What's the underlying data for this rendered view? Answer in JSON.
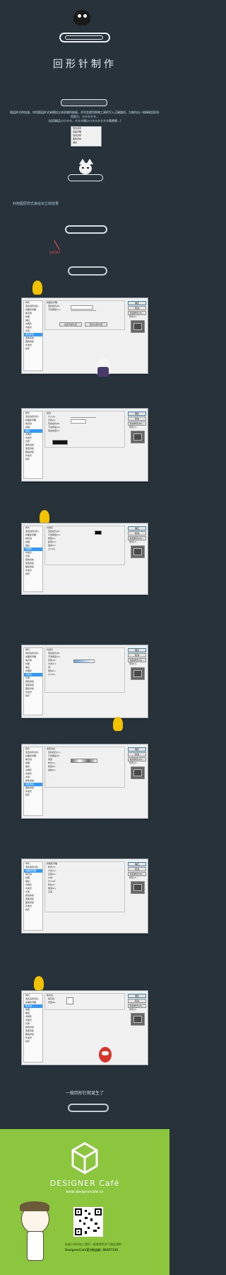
{
  "header": {
    "title": "回形针制作",
    "intro_line1": "图层样式的加减，何用图层样式来模拟立体质感的曲面，并学会使用钢笔工具的写入正确路径，为制作出一枚精致回形针而努力，卡卡卡卡卡…",
    "intro_line2": "(适用精品小小卡卡，卡卡卡哦小小卡卡卡卡卡卡哦喂喂…)",
    "step_note": "利用图层样式来给出立体效果",
    "color_code": "b7b7b7",
    "ending": "一枚回形针就诞生了"
  },
  "small_dialog": {
    "items": [
      "混合选项",
      "斜面浮雕",
      "混合边缘",
      "图案叠加",
      "描边"
    ]
  },
  "ps_dialogs": [
    {
      "title": "斜面和浮雕",
      "sidebar": [
        "样式",
        "混合选项:默认",
        "斜面和浮雕",
        "等高线",
        "纹理",
        "描边",
        "内阴影",
        "内发光",
        "光泽",
        "颜色叠加",
        "渐变叠加",
        "图案叠加",
        "外发光",
        "投影"
      ],
      "selected": 9,
      "buttons": [
        "确定",
        "取消",
        "新建样式(W)...",
        "预览(V)"
      ],
      "rows": [
        "混合模式(B):",
        "不透明度(O):",
        "设置为默认值",
        "复位为默认值"
      ]
    },
    {
      "title": "描边",
      "sidebar": [
        "样式",
        "混合选项:默认",
        "斜面和浮雕",
        "等高线",
        "纹理",
        "描边",
        "内阴影",
        "内发光",
        "光泽",
        "颜色叠加",
        "渐变叠加",
        "图案叠加",
        "外发光",
        "投影"
      ],
      "selected": 5,
      "buttons": [
        "确定",
        "取消",
        "新建样式(W)...",
        "预览(V)"
      ],
      "rows": [
        "大小(S):",
        "位置(P):",
        "混合模式(B):",
        "不透明度(O):",
        "填充类型(F):"
      ]
    },
    {
      "title": "内阴影",
      "sidebar": [
        "样式",
        "混合选项:默认",
        "斜面和浮雕",
        "等高线",
        "纹理",
        "描边",
        "内阴影",
        "内发光",
        "光泽",
        "颜色叠加",
        "渐变叠加",
        "图案叠加",
        "外发光",
        "投影"
      ],
      "selected": 6,
      "buttons": [
        "确定",
        "取消",
        "新建样式(W)...",
        "预览(V)"
      ],
      "rows": [
        "混合模式(B):",
        "不透明度(O):",
        "角度(A):",
        "距离(D):",
        "阻塞(C):",
        "大小(S):"
      ]
    },
    {
      "title": "内发光",
      "sidebar": [
        "样式",
        "混合选项:默认",
        "斜面和浮雕",
        "等高线",
        "纹理",
        "描边",
        "内阴影",
        "内发光",
        "光泽",
        "颜色叠加",
        "渐变叠加",
        "图案叠加",
        "外发光",
        "投影"
      ],
      "selected": 7,
      "buttons": [
        "确定",
        "取消",
        "新建样式(W)...",
        "预览(V)"
      ],
      "rows": [
        "混合模式(B):",
        "不透明度(O):",
        "杂色(N):",
        "方法(Q):",
        "源:",
        "阻塞(C):",
        "大小(S):"
      ]
    },
    {
      "title": "渐变叠加",
      "sidebar": [
        "样式",
        "混合选项:默认",
        "斜面和浮雕",
        "等高线",
        "纹理",
        "描边",
        "内阴影",
        "内发光",
        "光泽",
        "颜色叠加",
        "渐变叠加",
        "图案叠加",
        "外发光",
        "投影"
      ],
      "selected": 10,
      "buttons": [
        "确定",
        "取消",
        "新建样式(W)...",
        "预览(V)"
      ],
      "rows": [
        "混合模式(O):",
        "不透明度(P):",
        "渐变:",
        "样式(L):",
        "角度(N):",
        "缩放(S):"
      ]
    },
    {
      "title": "斜面和浮雕",
      "sidebar": [
        "样式",
        "混合选项:默认",
        "斜面和浮雕",
        "等高线",
        "纹理",
        "描边",
        "内阴影",
        "内发光",
        "光泽",
        "颜色叠加",
        "渐变叠加",
        "图案叠加",
        "外发光",
        "投影"
      ],
      "selected": 2,
      "buttons": [
        "确定",
        "取消",
        "新建样式(W)...",
        "预览(V)"
      ],
      "rows": [
        "样式(T):",
        "方法(Q):",
        "深度(D):",
        "方向:",
        "大小(Z):",
        "软化(F):",
        "角度(N):",
        "高度:"
      ]
    },
    {
      "title": "等高线",
      "sidebar": [
        "样式",
        "混合选项:默认",
        "斜面和浮雕",
        "等高线",
        "纹理",
        "描边",
        "内阴影",
        "内发光",
        "光泽",
        "颜色叠加",
        "渐变叠加",
        "图案叠加",
        "外发光",
        "投影"
      ],
      "selected": 3,
      "buttons": [
        "确定",
        "取消",
        "新建样式(W)...",
        "预览(V)"
      ],
      "rows": [
        "等高线:",
        "范围(R):"
      ]
    }
  ],
  "footer": {
    "brand": "DESIGNER Café",
    "url": "www.designercafe.cn",
    "qr_text1": "欢迎小伙伴加入我们一起做我的学习和反馈吧",
    "qr_text2": "DesignerCafe官方粉丝群: 88057191"
  },
  "colors": {
    "bg": "#27323b",
    "green": "#8cc63f",
    "accent": "#3399ff"
  }
}
